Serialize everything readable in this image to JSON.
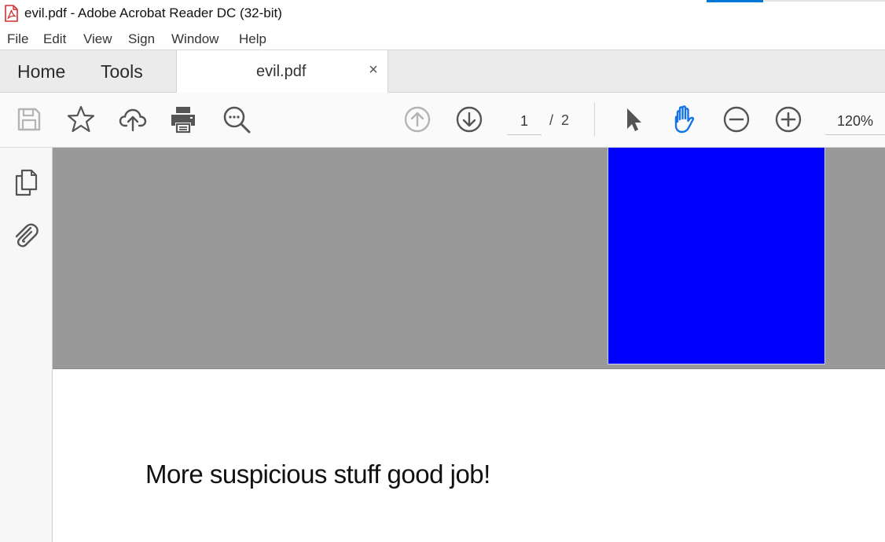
{
  "window": {
    "title": "evil.pdf - Adobe Acrobat Reader DC (32-bit)",
    "app_icon": "pdf-icon"
  },
  "menu": {
    "items": [
      "File",
      "Edit",
      "View",
      "Sign",
      "Window",
      "Help"
    ]
  },
  "tabs": {
    "home": "Home",
    "tools": "Tools",
    "document": {
      "label": "evil.pdf",
      "close": "×"
    }
  },
  "toolbar": {
    "icons": [
      "save-icon",
      "star-icon",
      "cloud-upload-icon",
      "print-icon",
      "search-icon",
      "previous-page-icon",
      "next-page-icon",
      "select-cursor-icon",
      "hand-tool-icon",
      "zoom-out-icon",
      "zoom-in-icon"
    ],
    "current_page": "1",
    "page_separator": "/",
    "total_pages": "2",
    "zoom": "120%",
    "active_tool": "hand-tool",
    "accent_color": "#1473e6"
  },
  "left_rail": {
    "icons": [
      "page-thumbnails-icon",
      "attachments-icon"
    ]
  },
  "document": {
    "box_color": "#0000ff",
    "page_background_gray": "#999999",
    "text": "More suspicious stuff good job!"
  }
}
